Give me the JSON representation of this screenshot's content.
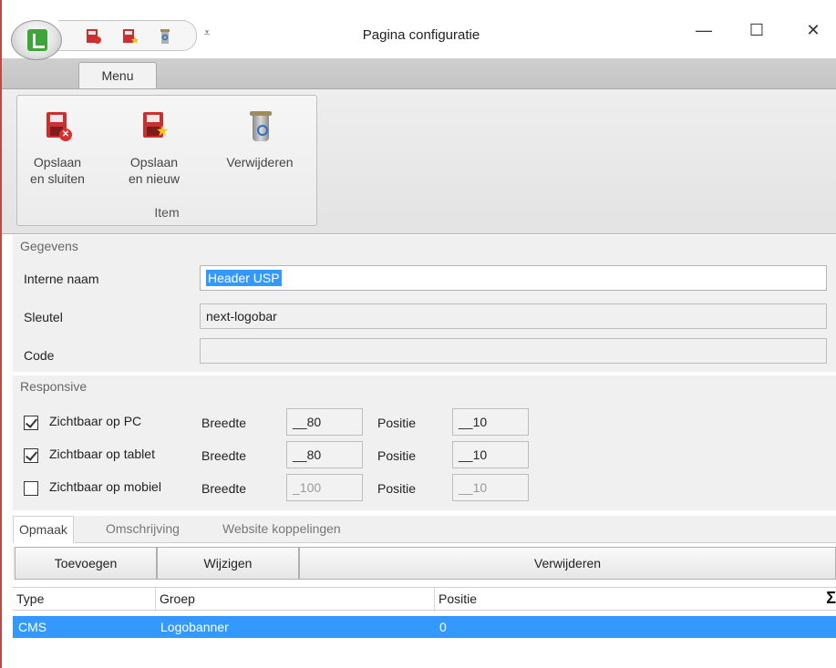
{
  "window": {
    "title": "Pagina configuratie",
    "minimize_glyph": "—",
    "maximize_glyph": "☐",
    "close_glyph": "✕",
    "qat_dropdown_glyph": "⩡"
  },
  "ribbon": {
    "tab_label": "Menu",
    "group_label": "Item",
    "buttons": [
      {
        "line1": "Opslaan",
        "line2": "en sluiten",
        "icon": "save-close-icon"
      },
      {
        "line1": "Opslaan",
        "line2": "en nieuw",
        "icon": "save-new-icon"
      },
      {
        "line1": "Verwijderen",
        "line2": "",
        "icon": "delete-icon"
      }
    ]
  },
  "gegevens": {
    "header": "Gegevens",
    "fields": [
      {
        "label": "Interne naam",
        "value": "Header USP"
      },
      {
        "label": "Sleutel",
        "value": "next-logobar"
      },
      {
        "label": "Code",
        "value": ""
      }
    ]
  },
  "responsive": {
    "header": "Responsive",
    "breedte_label": "Breedte",
    "positie_label": "Positie",
    "rows": [
      {
        "label": "Zichtbaar op PC",
        "checked": true,
        "breedte": "__80",
        "positie": "__10"
      },
      {
        "label": "Zichtbaar op tablet",
        "checked": true,
        "breedte": "__80",
        "positie": "__10"
      },
      {
        "label": "Zichtbaar op mobiel",
        "checked": false,
        "breedte": "_100",
        "positie": "__10"
      }
    ]
  },
  "tabs": [
    "Opmaak",
    "Omschrijving",
    "Website koppelingen"
  ],
  "grid": {
    "toolbar": [
      "Toevoegen",
      "Wijzigen",
      "Verwijderen"
    ],
    "columns": [
      "Type",
      "Groep",
      "Positie"
    ],
    "sigma": "Σ",
    "rows": [
      {
        "type": "CMS",
        "groep": "Logobanner",
        "positie": "0"
      }
    ]
  },
  "colors": {
    "selection": "#3399ff",
    "accent_red": "#c8312f",
    "logo_green": "#3fa43a"
  }
}
